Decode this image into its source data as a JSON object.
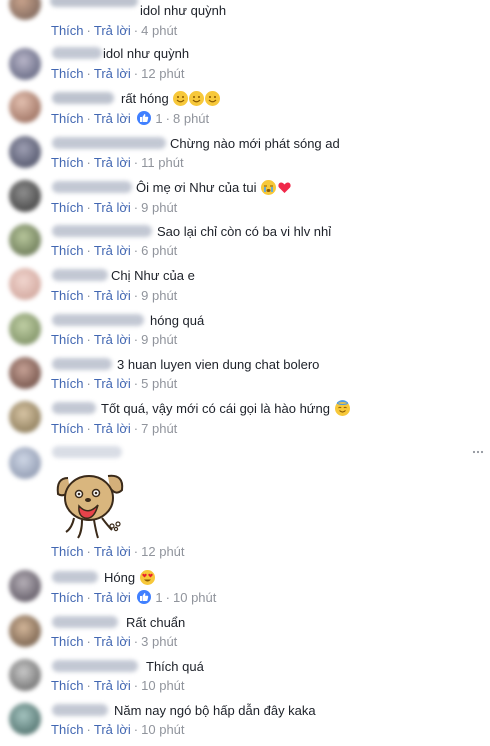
{
  "actions": {
    "like": "Thích",
    "reply": "Trả lời",
    "separator": "·"
  },
  "colors": {
    "link": "#4267b2",
    "muted": "#90949c",
    "like_badge": "#4080ff"
  },
  "comments": [
    {
      "text": "idol như quỳnh",
      "time": "4 phút",
      "reactions": null,
      "emojis": []
    },
    {
      "text": "idol như quỳnh",
      "time": "12 phút",
      "reactions": null,
      "emojis": []
    },
    {
      "text": "rất hóng",
      "time": "8 phút",
      "reactions": "1",
      "emojis": [
        "smile-emoji",
        "smile-emoji",
        "smile-emoji"
      ]
    },
    {
      "text": "Chừng nào mới phát sóng ad",
      "time": "11 phút",
      "reactions": null,
      "emojis": []
    },
    {
      "text": "Ôi mẹ ơi Như của tui",
      "time": "9 phút",
      "reactions": null,
      "emojis": [
        "crying-emoji",
        "heart-emoji"
      ]
    },
    {
      "text": "Sao lại chỉ còn có ba vi hlv nhỉ",
      "time": "6 phút",
      "reactions": null,
      "emojis": []
    },
    {
      "text": "Chị Như của e",
      "time": "9 phút",
      "reactions": null,
      "emojis": []
    },
    {
      "text": "hóng quá",
      "time": "9 phút",
      "reactions": null,
      "emojis": []
    },
    {
      "text": "3 huan luyen vien dung chat bolero",
      "time": "5 phút",
      "reactions": null,
      "emojis": []
    },
    {
      "text": "Tốt quá, vậy mới có cái gọi là hào hứng",
      "time": "7 phút",
      "reactions": null,
      "emojis": [
        "halo-emoji"
      ]
    },
    {
      "text": "",
      "time": "12 phút",
      "reactions": null,
      "emojis": [],
      "sticker": "dog-sticker"
    },
    {
      "text": "Hóng",
      "time": "10 phút",
      "reactions": "1",
      "emojis": [
        "heart-eyes-emoji"
      ]
    },
    {
      "text": "Rất chuẩn",
      "time": "3 phút",
      "reactions": null,
      "emojis": []
    },
    {
      "text": "Thích quá",
      "time": "10 phút",
      "reactions": null,
      "emojis": []
    },
    {
      "text": "Năm nay ngó bộ hấp dẫn đây kaka",
      "time": "10 phút",
      "reactions": null,
      "emojis": []
    }
  ]
}
